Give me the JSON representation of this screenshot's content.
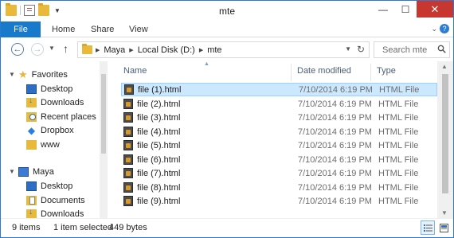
{
  "window": {
    "title": "mte",
    "controls": {
      "minimize": "—",
      "maximize": "☐",
      "close": "✕"
    }
  },
  "ribbon": {
    "tabs": [
      "File",
      "Home",
      "Share",
      "View"
    ],
    "help": "?"
  },
  "address": {
    "crumbs": [
      "Maya",
      "Local Disk (D:)",
      "mte"
    ]
  },
  "search": {
    "placeholder": "Search mte"
  },
  "nav": {
    "favorites_label": "Favorites",
    "favorites": [
      "Desktop",
      "Downloads",
      "Recent places",
      "Dropbox",
      "www"
    ],
    "pc_label": "Maya",
    "pc_items": [
      "Desktop",
      "Documents",
      "Downloads"
    ]
  },
  "columns": {
    "name": "Name",
    "date": "Date modified",
    "type": "Type"
  },
  "files": [
    {
      "name": "file (1).html",
      "date": "7/10/2014 6:19 PM",
      "type": "HTML File",
      "selected": true
    },
    {
      "name": "file (2).html",
      "date": "7/10/2014 6:19 PM",
      "type": "HTML File"
    },
    {
      "name": "file (3).html",
      "date": "7/10/2014 6:19 PM",
      "type": "HTML File"
    },
    {
      "name": "file (4).html",
      "date": "7/10/2014 6:19 PM",
      "type": "HTML File"
    },
    {
      "name": "file (5).html",
      "date": "7/10/2014 6:19 PM",
      "type": "HTML File"
    },
    {
      "name": "file (6).html",
      "date": "7/10/2014 6:19 PM",
      "type": "HTML File"
    },
    {
      "name": "file (7).html",
      "date": "7/10/2014 6:19 PM",
      "type": "HTML File"
    },
    {
      "name": "file (8).html",
      "date": "7/10/2014 6:19 PM",
      "type": "HTML File"
    },
    {
      "name": "file (9).html",
      "date": "7/10/2014 6:19 PM",
      "type": "HTML File"
    }
  ],
  "status": {
    "item_count": "9 items",
    "selection": "1 item selected",
    "size": "449 bytes"
  },
  "colors": {
    "accent": "#1979ca",
    "selection_bg": "#cce8ff",
    "close_button": "#c7372f"
  }
}
